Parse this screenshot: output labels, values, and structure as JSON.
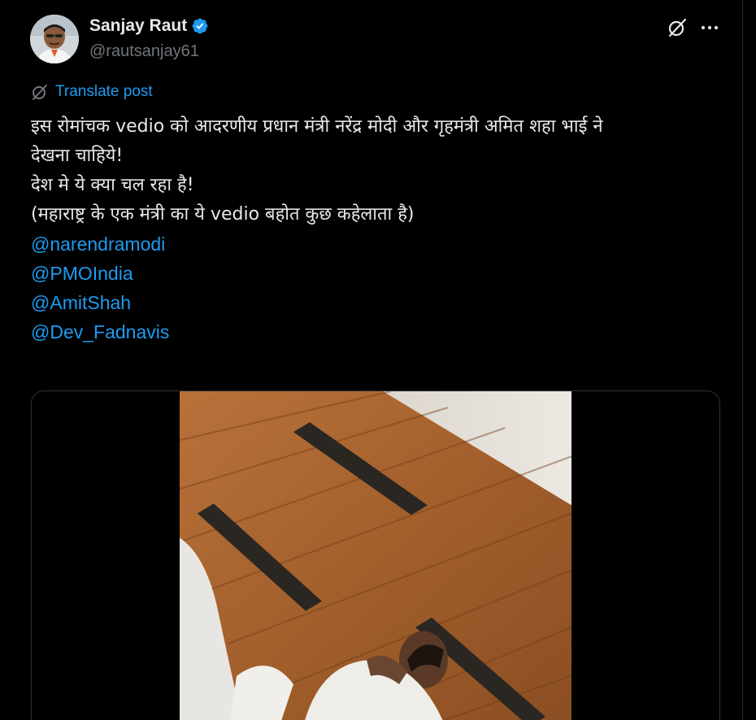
{
  "post": {
    "author": {
      "display_name": "Sanjay Raut",
      "handle": "@rautsanjay61",
      "verified": true
    },
    "translate_label": "Translate post",
    "text_lines": [
      "इस रोमांचक vedio को आदरणीय प्रधान मंत्री नरेंद्र मोदी और गृहमंत्री अमित शहा भाई ने",
      "देखना चाहिये!",
      "देश मे ये क्या चल रहा है!",
      "(महाराष्ट्र के एक मंत्री का ये vedio बहोत कुछ कहेलाता है)"
    ],
    "mentions": [
      "@narendramodi",
      "@PMOIndia",
      "@AmitShah",
      "@Dev_Fadnavis"
    ],
    "media": {
      "type": "video"
    }
  },
  "icons": {
    "verified": "verified-badge-icon",
    "grok": "grok-icon",
    "more": "more-options-icon",
    "translate": "translate-globe-icon"
  },
  "colors": {
    "background": "#000000",
    "text_primary": "#e7e9ea",
    "text_secondary": "#71767b",
    "accent": "#1d9bf0",
    "border": "#2f3336"
  }
}
